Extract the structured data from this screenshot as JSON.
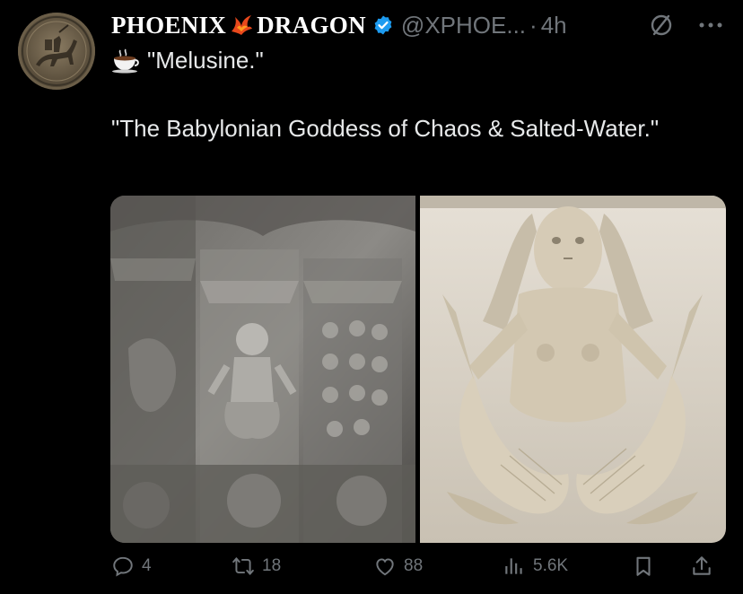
{
  "author": {
    "name_part1": "PHOENIX",
    "name_part2": "DRAGON",
    "handle": "@XPHOE...",
    "separator": "·",
    "time": "4h"
  },
  "post": {
    "line1": "\"Melusine.\"",
    "paragraph": "\"The Babylonian Goddess of Chaos & Salted-Water.\""
  },
  "media": {
    "left_image": "carved-stone-portal-with-mermaid-relief",
    "right_image": "stone-relief-of-two-tailed-mermaid"
  },
  "actions": {
    "replies": "4",
    "reposts": "18",
    "likes": "88",
    "views": "5.6K"
  },
  "colors": {
    "background": "#000000",
    "text": "#e7e9ea",
    "muted": "#71767b",
    "verified": "#1d9bf0"
  },
  "icons": [
    "avatar",
    "phoenix-emoji",
    "verified-badge-icon",
    "grok-icon",
    "more-icon",
    "coffee-emoji",
    "reply-icon",
    "repost-icon",
    "like-icon",
    "views-icon",
    "bookmark-icon",
    "share-icon"
  ]
}
